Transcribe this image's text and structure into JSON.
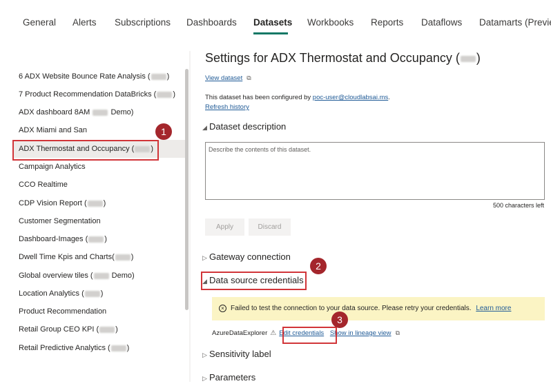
{
  "tabs": [
    "General",
    "Alerts",
    "Subscriptions",
    "Dashboards",
    "Datasets",
    "Workbooks",
    "Reports",
    "Dataflows",
    "Datamarts (Preview"
  ],
  "active_tab": "Datasets",
  "sidebar": {
    "items": [
      "6 ADX Website Bounce Rate Analysis (",
      "7 Product Recommendation DataBricks (",
      "ADX dashboard 8AM",
      "ADX Miami and San",
      "ADX Thermostat and Occupancy (",
      "Campaign Analytics",
      "CCO Realtime",
      "CDP Vision Report (",
      "Customer Segmentation",
      "Dashboard-Images (",
      "Dwell Time Kpis and Charts(",
      "Global overview tiles (",
      "Location Analytics (",
      "Product Recommendation",
      "Retail Group CEO KPI (",
      "Retail Predictive Analytics ("
    ],
    "suffixes": {
      "0": ")",
      "1": ")",
      "2": " Demo)",
      "4": ")",
      "7": ")",
      "9": ")",
      "10": ")",
      "11": " Demo)",
      "12": ")",
      "14": ")",
      "15": ")"
    }
  },
  "main": {
    "title": "Settings for ADX Thermostat and Occupancy (",
    "title_suffix": ")",
    "view_dataset": "View dataset",
    "configured_text": "This dataset has been configured by ",
    "configured_user": "poc-user@cloudlabsai.ms",
    "configured_end": ".",
    "refresh_history": "Refresh history",
    "dataset_description": "Dataset description",
    "description_placeholder": "Describe the contents of this dataset.",
    "chars_left": "500 characters left",
    "apply": "Apply",
    "discard": "Discard",
    "gateway_connection": "Gateway connection",
    "data_source_credentials": "Data source credentials",
    "warning_text": "Failed to test the connection to your data source. Please retry your credentials.",
    "learn_more": "Learn more",
    "source_name": "AzureDataExplorer",
    "edit_credentials": "Edit credentials",
    "lineage_view": "Show in lineage view",
    "sensitivity_label": "Sensitivity label",
    "parameters": "Parameters"
  },
  "annotations": [
    "1",
    "2",
    "3"
  ],
  "colors": {
    "accent": "#117865",
    "link": "#1f5a96",
    "annotation_red": "#d13438",
    "badge_red": "#a4262c",
    "warning_bg": "#fbf4c4"
  }
}
